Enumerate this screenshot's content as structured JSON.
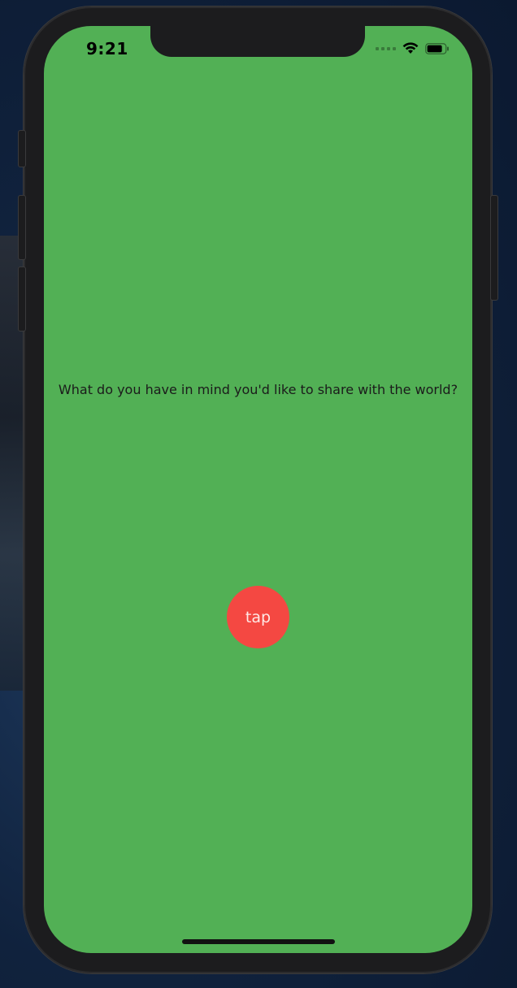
{
  "status_bar": {
    "time": "9:21",
    "icons": [
      "cellular-signal-icon",
      "wifi-icon",
      "battery-icon"
    ]
  },
  "main": {
    "message": "What do you have in mind you'd like to share with the world?",
    "tap_button_label": "tap"
  },
  "colors": {
    "background": "#52b055",
    "button": "#f44842",
    "button_text": "#ffe9e6",
    "text": "#1b1b1b"
  }
}
